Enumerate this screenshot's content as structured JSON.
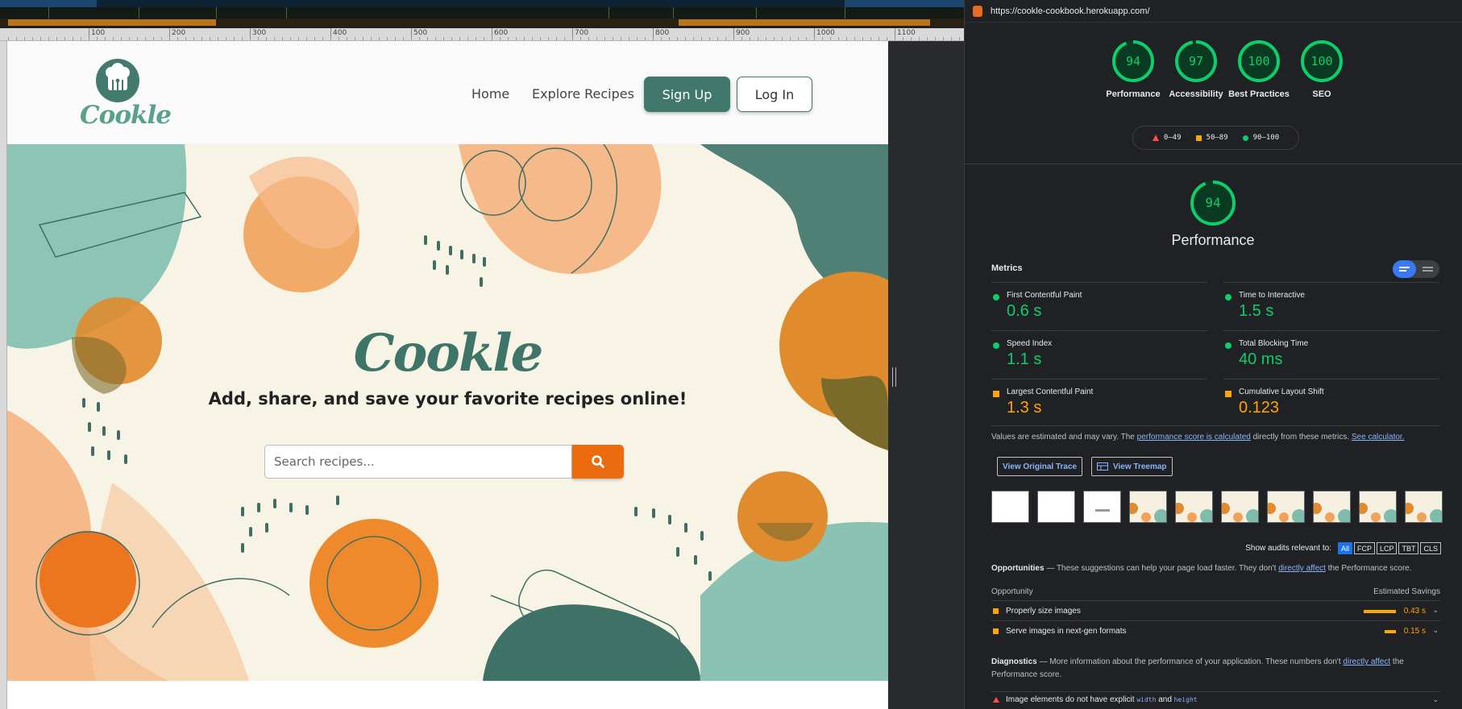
{
  "ruler": {
    "marks": [
      "100",
      "200",
      "300",
      "400",
      "500",
      "600",
      "700",
      "800",
      "900",
      "1000",
      "1100"
    ]
  },
  "site": {
    "logo": {
      "text": "Cookle"
    },
    "nav": {
      "home": "Home",
      "explore": "Explore Recipes",
      "signup": "Sign Up",
      "login": "Log In"
    },
    "hero": {
      "title": "Cookle",
      "tagline": "Add, share, and save your favorite recipes online!",
      "search_placeholder": "Search recipes..."
    },
    "colors": {
      "brand_green": "#40786c",
      "accent_orange": "#ec6b0f",
      "hero_bg": "#f7f4e6"
    }
  },
  "lighthouse": {
    "url": "https://cookle-cookbook.herokuapp.com/",
    "gauges": [
      {
        "score": "94",
        "label": "Performance",
        "fraction": 0.94
      },
      {
        "score": "97",
        "label": "Accessibility",
        "fraction": 0.97
      },
      {
        "score": "100",
        "label": "Best Practices",
        "fraction": 1.0
      },
      {
        "score": "100",
        "label": "SEO",
        "fraction": 1.0
      }
    ],
    "legend": {
      "fail": "0–49",
      "average": "50–89",
      "pass": "90–100"
    },
    "main": {
      "score": "94",
      "title": "Performance",
      "fraction": 0.94
    },
    "metrics_title": "Metrics",
    "metrics": [
      {
        "name": "First Contentful Paint",
        "value": "0.6 s",
        "status": "good"
      },
      {
        "name": "Time to Interactive",
        "value": "1.5 s",
        "status": "good"
      },
      {
        "name": "Speed Index",
        "value": "1.1 s",
        "status": "good"
      },
      {
        "name": "Total Blocking Time",
        "value": "40 ms",
        "status": "good"
      },
      {
        "name": "Largest Contentful Paint",
        "value": "1.3 s",
        "status": "average"
      },
      {
        "name": "Cumulative Layout Shift",
        "value": "0.123",
        "status": "average"
      }
    ],
    "note": {
      "prefix": "Values are estimated and may vary. The ",
      "link1": "performance score is calculated",
      "middle": " directly from these metrics. ",
      "link2": "See calculator."
    },
    "buttons": {
      "trace": "View Original Trace",
      "treemap": "View Treemap"
    },
    "filter": {
      "label": "Show audits relevant to:",
      "chips": [
        "All",
        "FCP",
        "LCP",
        "TBT",
        "CLS"
      ]
    },
    "opportunities": {
      "title": "Opportunities",
      "desc_prefix": " — These suggestions can help your page load faster. They don't ",
      "desc_link": "directly affect",
      "desc_suffix": " the Performance score.",
      "col_left": "Opportunity",
      "col_right": "Estimated Savings",
      "items": [
        {
          "name": "Properly size images",
          "value": "0.43 s",
          "fraction": 0.43
        },
        {
          "name": "Serve images in next-gen formats",
          "value": "0.15 s",
          "fraction": 0.15
        }
      ]
    },
    "diagnostics": {
      "title": "Diagnostics",
      "desc_prefix": " — More information about the performance of your application. These numbers don't ",
      "desc_link": "directly affect",
      "desc_suffix": " the Performance score.",
      "item_prefix": "Image elements do not have explicit ",
      "item_code1": "width",
      "item_and": " and ",
      "item_code2": "height"
    }
  }
}
